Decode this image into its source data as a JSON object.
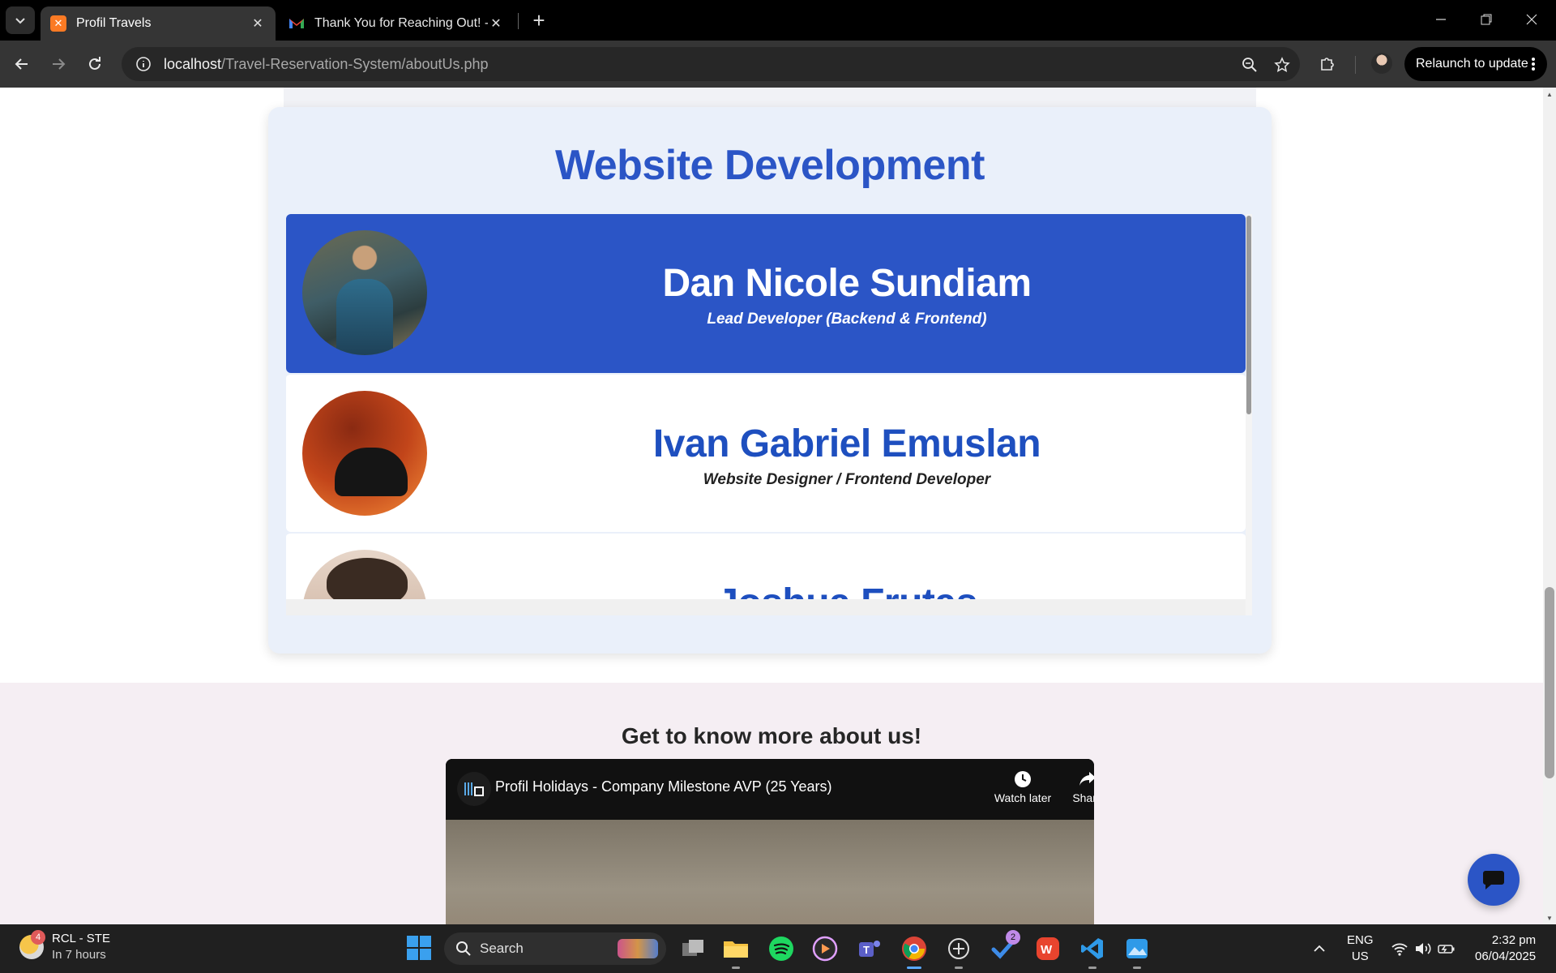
{
  "browser": {
    "tabs": [
      {
        "title": "Profil Travels",
        "active": true
      },
      {
        "title": "Thank You for Reaching Out! - c",
        "active": false
      }
    ],
    "url_host": "localhost",
    "url_path": "/Travel-Reservation-System/aboutUs.php",
    "relaunch_label": "Relaunch to update"
  },
  "page": {
    "dev_section": {
      "title": "Website Development",
      "members": [
        {
          "name": "Dan Nicole Sundiam",
          "role": "Lead Developer (Backend & Frontend)",
          "highlighted": true
        },
        {
          "name": "Ivan Gabriel Emuslan",
          "role": "Website Designer / Frontend Developer",
          "highlighted": false
        },
        {
          "name": "Joshua Frutas",
          "role": "",
          "highlighted": false
        }
      ]
    },
    "more_section": {
      "title": "Get to know more about us!",
      "video": {
        "title": "Profil Holidays - Company Milestone AVP (25 Years)",
        "watch_later_label": "Watch later",
        "share_label": "Share"
      }
    }
  },
  "colors": {
    "accent": "#2b55c6",
    "card_bg": "#eaf0fa",
    "section_bg": "#f5eef3"
  },
  "taskbar": {
    "weather_badge": "4",
    "weather_title": "RCL - STE",
    "weather_sub": "In 7 hours",
    "search_label": "Search",
    "todo_badge": "2",
    "lang_top": "ENG",
    "lang_bottom": "US",
    "time": "2:32 pm",
    "date": "06/04/2025"
  }
}
